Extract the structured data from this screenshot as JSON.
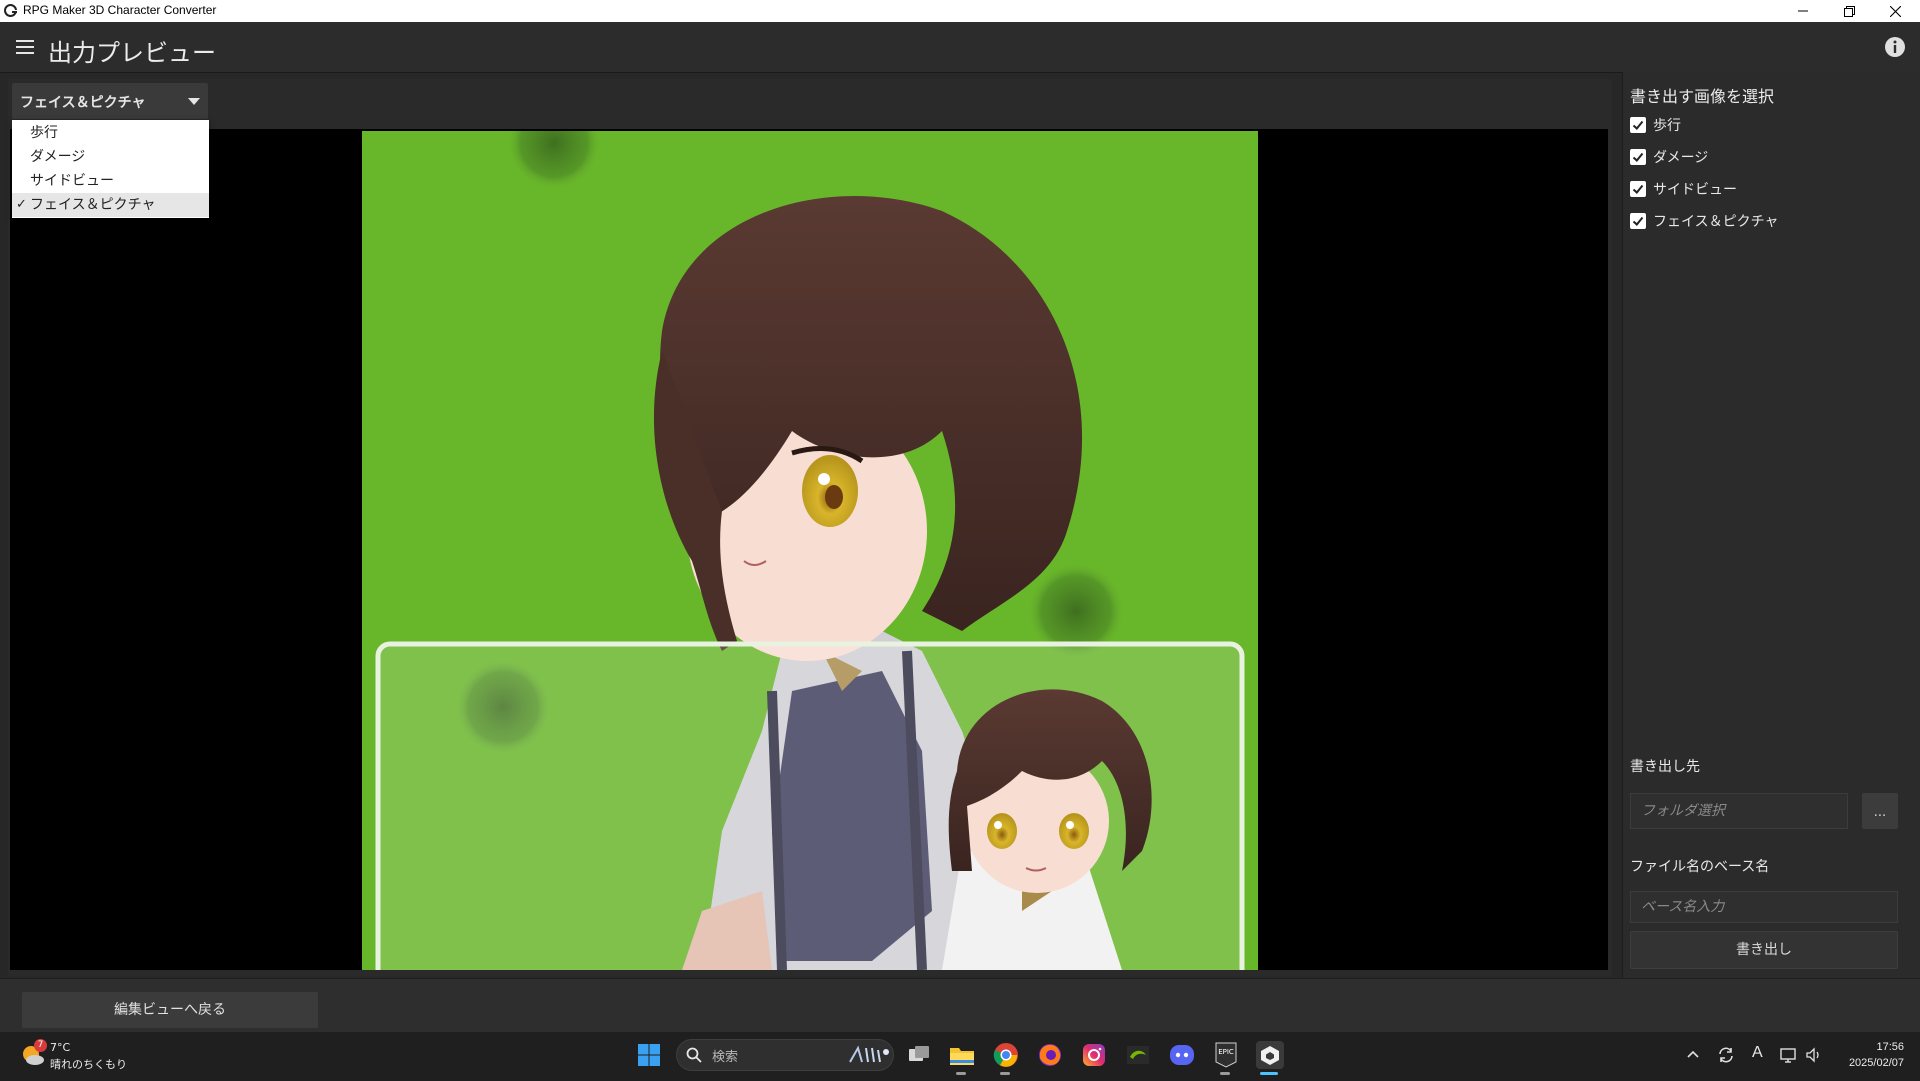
{
  "window": {
    "title": "RPG Maker 3D Character Converter"
  },
  "header": {
    "title": "出力プレビュー",
    "menu_icon": "hamburger-menu-icon",
    "info_icon": "info-icon"
  },
  "preview": {
    "mode_select": {
      "selected": "フェイス＆ピクチャ",
      "options": [
        "歩行",
        "ダメージ",
        "サイドビュー",
        "フェイス＆ピクチャ"
      ],
      "checked_index": 3
    }
  },
  "export_panel": {
    "heading": "書き出す画像を選択",
    "checkboxes": [
      {
        "label": "歩行",
        "checked": true
      },
      {
        "label": "ダメージ",
        "checked": true
      },
      {
        "label": "サイドビュー",
        "checked": true
      },
      {
        "label": "フェイス＆ピクチャ",
        "checked": true
      }
    ],
    "destination_label": "書き出し先",
    "folder_placeholder": "フォルダ選択",
    "browse_label": "...",
    "basename_label": "ファイル名のベース名",
    "basename_placeholder": "ベース名入力",
    "export_button": "書き出し"
  },
  "bottom": {
    "back_button": "編集ビューへ戻る"
  },
  "taskbar": {
    "weather": {
      "temp": "7°C",
      "desc": "晴れのちくもり",
      "badge": "7"
    },
    "search_placeholder": "検索",
    "apps": [
      "task-view-icon",
      "file-explorer-icon",
      "chrome-icon",
      "firefox-icon",
      "instagram-icon",
      "nvidia-icon",
      "discord-icon",
      "epic-games-icon",
      "unity-icon"
    ],
    "tray": [
      "chevron-up-icon",
      "sync-icon",
      "ime-icon",
      "network-icon",
      "volume-icon"
    ],
    "ime_label": "A",
    "clock": {
      "time": "17:56",
      "date": "2025/02/07"
    }
  },
  "colors": {
    "app_bg": "#272727",
    "grass": "#6fbf2e",
    "hair": "#4a2f28",
    "eye": "#d8b52a"
  }
}
